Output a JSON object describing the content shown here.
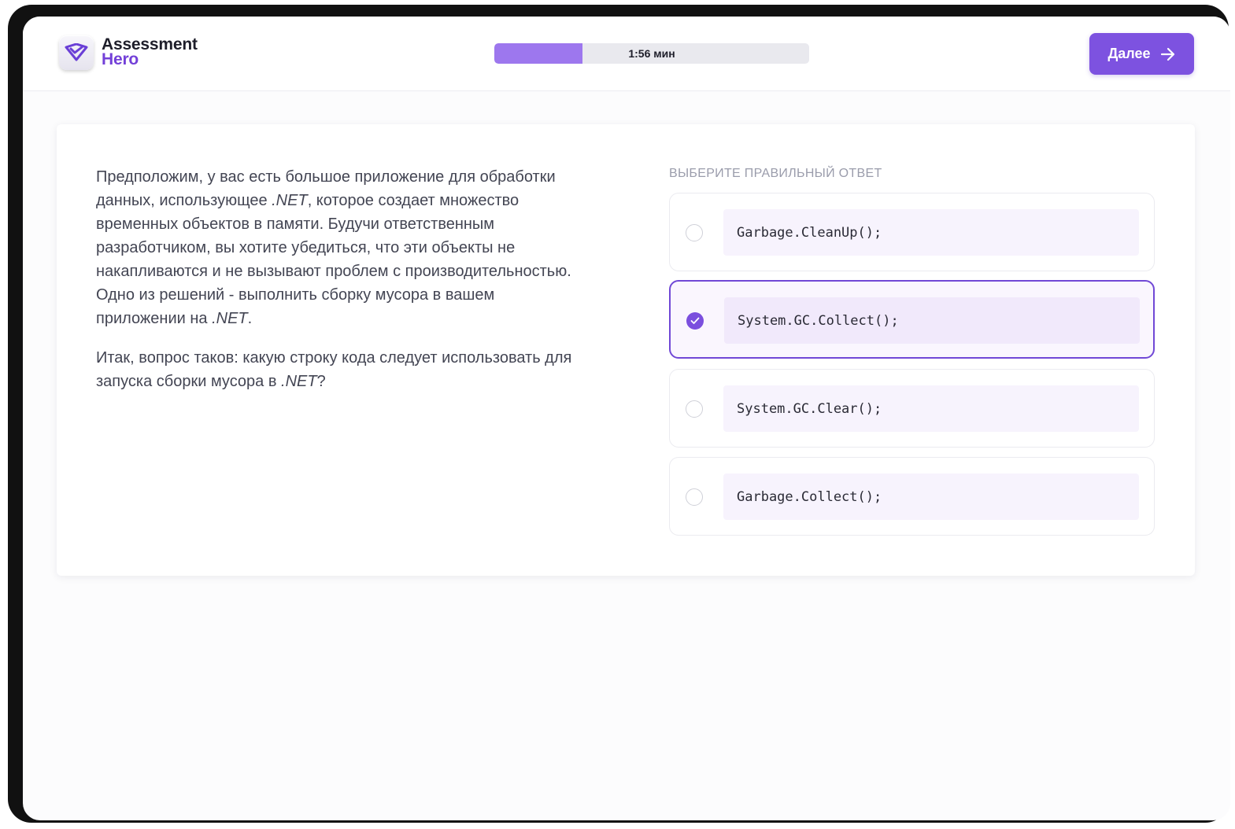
{
  "header": {
    "brand_line1": "Assessment",
    "brand_line2": "Hero",
    "timer_text": "1:56 мин",
    "progress_fraction": 0.28,
    "next_label": "Далее"
  },
  "question": {
    "part1_a": "Предположим, у вас есть большое приложение для обработки данных, использующее ",
    "part1_b": ".NET",
    "part1_c": ", которое создает множество временных объектов в памяти. Будучи ответственным разработчиком, вы хотите убедиться, что эти объекты не накапливаются и не вызывают проблем с производительностью. Одно из решений - выполнить сборку мусора в вашем приложении на ",
    "part1_d": ".NET",
    "part1_e": ".",
    "part2_a": "Итак, вопрос таков: какую строку кода следует использовать для запуска сборки мусора в ",
    "part2_b": ".NET",
    "part2_c": "?"
  },
  "answers": {
    "title": "ВЫБЕРИТЕ ПРАВИЛЬНЫЙ ОТВЕТ",
    "options": [
      {
        "code": "Garbage.CleanUp();",
        "selected": false
      },
      {
        "code": "System.GC.Collect();",
        "selected": true
      },
      {
        "code": "System.GC.Clear();",
        "selected": false
      },
      {
        "code": "Garbage.Collect();",
        "selected": false
      }
    ]
  },
  "colors": {
    "accent": "#7d52e0",
    "brand_purple": "#7340d8",
    "progress_fill": "#9d77ee"
  },
  "icons": {
    "logo": "check-shield-icon",
    "next": "arrow-right-icon",
    "selected_radio": "checkmark-icon"
  }
}
